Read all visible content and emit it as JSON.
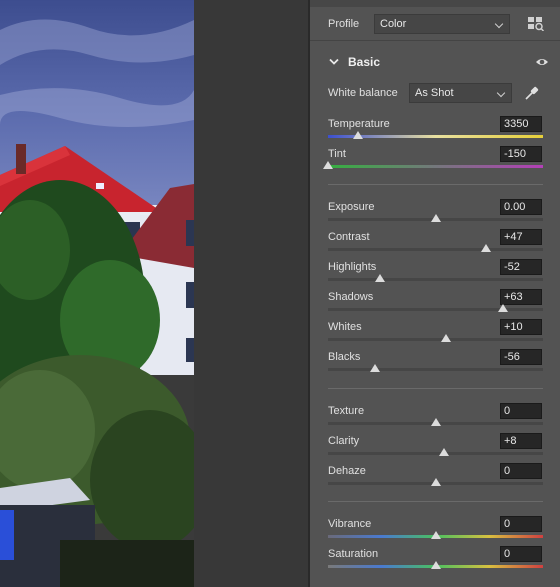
{
  "profile": {
    "label": "Profile",
    "value": "Color",
    "browse_icon": "grid-browse-icon"
  },
  "basic": {
    "title": "Basic",
    "collapse_icon": "chevron-down-icon",
    "visibility_icon": "eye-icon",
    "white_balance": {
      "label": "White balance",
      "value": "As Shot",
      "picker_icon": "eyedropper-icon"
    },
    "sliders": {
      "temperature": {
        "label": "Temperature",
        "value": "3350",
        "pos": 0.14
      },
      "tint": {
        "label": "Tint",
        "value": "-150",
        "pos": 0.0
      },
      "exposure": {
        "label": "Exposure",
        "value": "0.00",
        "pos": 0.5
      },
      "contrast": {
        "label": "Contrast",
        "value": "+47",
        "pos": 0.735
      },
      "highlights": {
        "label": "Highlights",
        "value": "-52",
        "pos": 0.24
      },
      "shadows": {
        "label": "Shadows",
        "value": "+63",
        "pos": 0.815
      },
      "whites": {
        "label": "Whites",
        "value": "+10",
        "pos": 0.55
      },
      "blacks": {
        "label": "Blacks",
        "value": "-56",
        "pos": 0.22
      },
      "texture": {
        "label": "Texture",
        "value": "0",
        "pos": 0.5
      },
      "clarity": {
        "label": "Clarity",
        "value": "+8",
        "pos": 0.54
      },
      "dehaze": {
        "label": "Dehaze",
        "value": "0",
        "pos": 0.5
      },
      "vibrance": {
        "label": "Vibrance",
        "value": "0",
        "pos": 0.5
      },
      "saturation": {
        "label": "Saturation",
        "value": "0",
        "pos": 0.5
      }
    }
  },
  "colors": {
    "panel_bg": "#535353",
    "track": "#464646",
    "thumb": "#dcdcdc",
    "temperature_gradient": [
      "#3b4fd0",
      "#e8e0a0",
      "#e6cf3a"
    ],
    "tint_gradient": [
      "#35b040",
      "#b43fb8"
    ]
  }
}
